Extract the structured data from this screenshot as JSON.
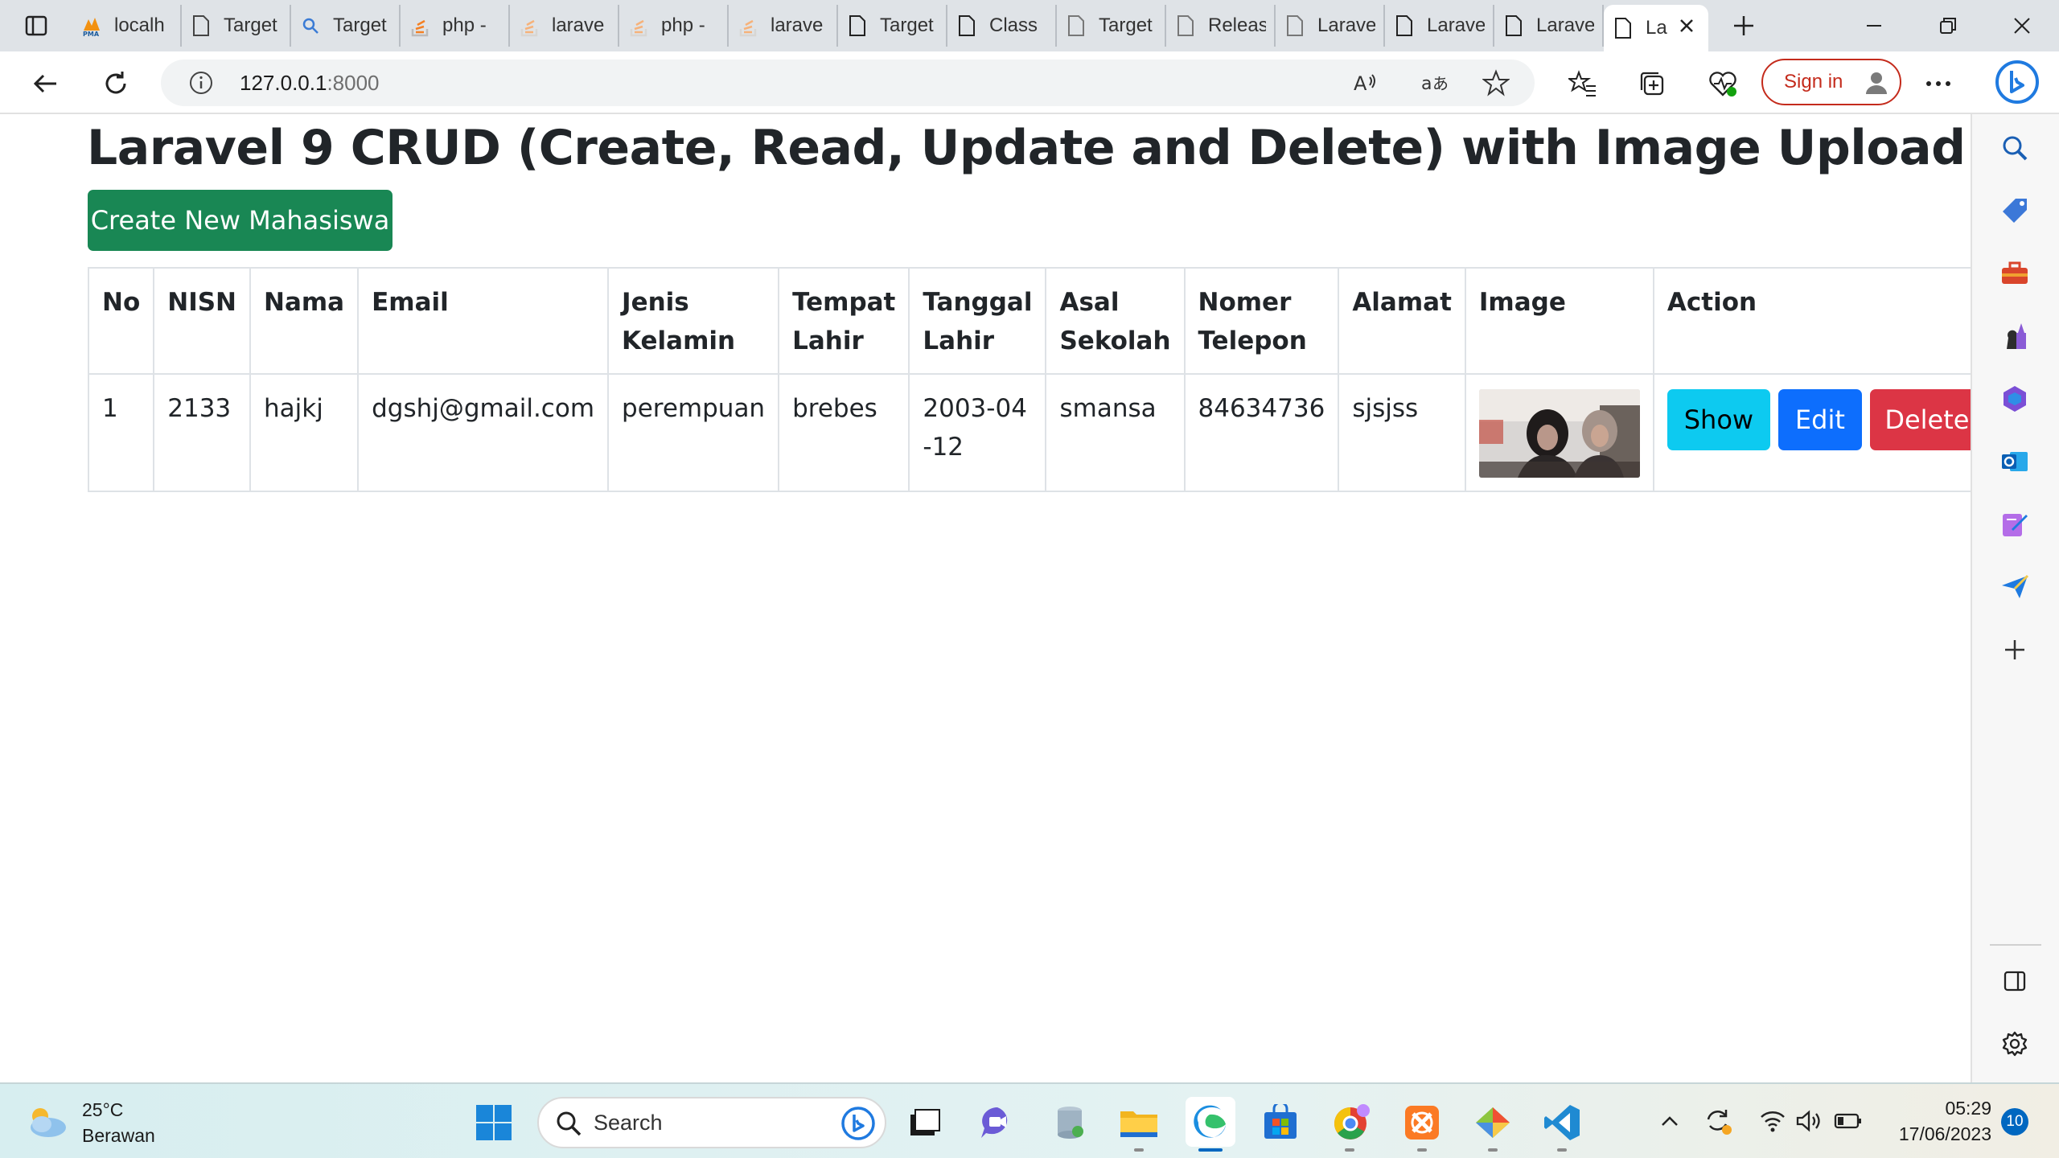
{
  "browser": {
    "tabs": [
      {
        "label": "localh",
        "icon": "phpmyadmin-icon"
      },
      {
        "label": "Target",
        "icon": "page-icon"
      },
      {
        "label": "Target",
        "icon": "search-icon"
      },
      {
        "label": "php -",
        "icon": "stackoverflow-icon"
      },
      {
        "label": "larave",
        "icon": "stackoverflow-icon"
      },
      {
        "label": "php -",
        "icon": "stackoverflow-icon"
      },
      {
        "label": "larave",
        "icon": "stackoverflow-icon"
      },
      {
        "label": "Target",
        "icon": "page-icon"
      },
      {
        "label": "Class",
        "icon": "page-icon"
      },
      {
        "label": "Target",
        "icon": "page-icon"
      },
      {
        "label": "Releas",
        "icon": "page-icon"
      },
      {
        "label": "Larave",
        "icon": "page-icon"
      },
      {
        "label": "Larave",
        "icon": "page-icon"
      },
      {
        "label": "Larave",
        "icon": "page-icon"
      },
      {
        "label": "La",
        "icon": "page-icon",
        "active": true
      }
    ],
    "address": {
      "host": "127.0.0.1",
      "port": ":8000"
    },
    "signin_label": "Sign in"
  },
  "page": {
    "title": "Laravel 9 CRUD (Create, Read, Update and Delete) with Image Upload",
    "create_button": "Create New Mahasiswa",
    "table": {
      "headers": {
        "no": "No",
        "nisn": "NISN",
        "nama": "Nama",
        "email": "Email",
        "jenis_kelamin": "Jenis Kelamin",
        "tempat_lahir": "Tempat Lahir",
        "tanggal_lahir": "Tanggal Lahir",
        "asal_sekolah": "Asal Sekolah",
        "nomer_telepon": "Nomer Telepon",
        "alamat": "Alamat",
        "image": "Image",
        "action": "Action"
      },
      "rows": [
        {
          "no": "1",
          "nisn": "2133",
          "nama": "hajkj",
          "email": "dgshj@gmail.com",
          "jenis_kelamin": "perempuan",
          "tempat_lahir": "brebes",
          "tanggal_lahir": "2003-04-12",
          "asal_sekolah": "smansa",
          "nomer_telepon": "84634736",
          "alamat": "sjsjss",
          "actions": {
            "show": "Show",
            "edit": "Edit",
            "delete": "Delete"
          }
        }
      ]
    },
    "colors": {
      "success": "#198754",
      "info": "#0dcaf0",
      "primary": "#0d6efd",
      "danger": "#dc3545"
    }
  },
  "taskbar": {
    "weather": {
      "temp": "25°C",
      "condition": "Berawan"
    },
    "search_placeholder": "Search",
    "clock": {
      "time": "05:29",
      "date": "17/06/2023"
    },
    "notification_count": "10"
  }
}
